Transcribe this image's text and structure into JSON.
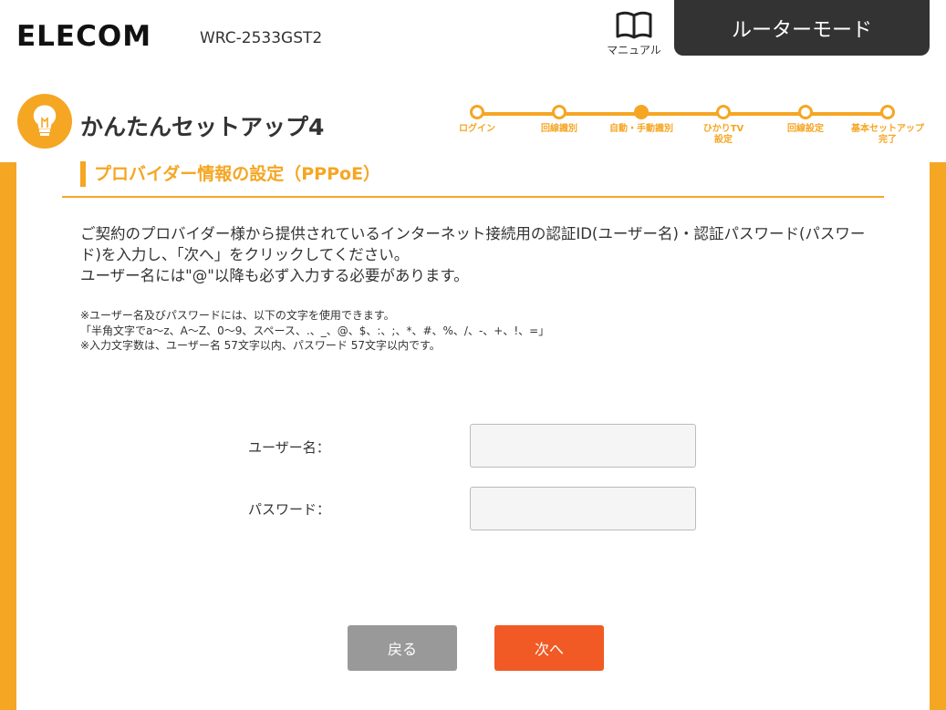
{
  "header": {
    "brand": "ELECOM",
    "model": "WRC-2533GST2",
    "manual_label": "マニュアル",
    "mode_label": "ルーターモード"
  },
  "setup": {
    "title": "かんたんセットアップ4",
    "steps": [
      {
        "label": "ログイン",
        "state": "done"
      },
      {
        "label": "回線識別",
        "state": "done"
      },
      {
        "label": "自動・手動識別",
        "state": "current"
      },
      {
        "label": "ひかりTV\n設定",
        "state": "pending"
      },
      {
        "label": "回線設定",
        "state": "pending"
      },
      {
        "label": "基本セットアップ\n完了",
        "state": "pending"
      }
    ]
  },
  "section": {
    "heading": "プロバイダー情報の設定（PPPoE）",
    "intro_line1": "ご契約のプロバイダー様から提供されているインターネット接続用の認証ID(ユーザー名)・認証パスワード(パスワード)を入力し、「次へ」をクリックしてください。",
    "intro_line2": "ユーザー名には\"@\"以降も必ず入力する必要があります。",
    "note1": "※ユーザー名及びパスワードには、以下の文字を使用できます。",
    "note2": "「半角文字でa～z、A～Z、0～9、スペース、.、_、@、$、:、;、*、#、%、/、-、+、!、=」",
    "note3": "※入力文字数は、ユーザー名 57文字以内、パスワード 57文字以内です。"
  },
  "form": {
    "username_label": "ユーザー名：",
    "username_value": "",
    "password_label": "パスワード：",
    "password_value": ""
  },
  "buttons": {
    "back": "戻る",
    "next": "次へ"
  },
  "colors": {
    "accent": "#f5a623",
    "next_button": "#f15a24",
    "back_button": "#999999",
    "mode_button": "#333333"
  }
}
